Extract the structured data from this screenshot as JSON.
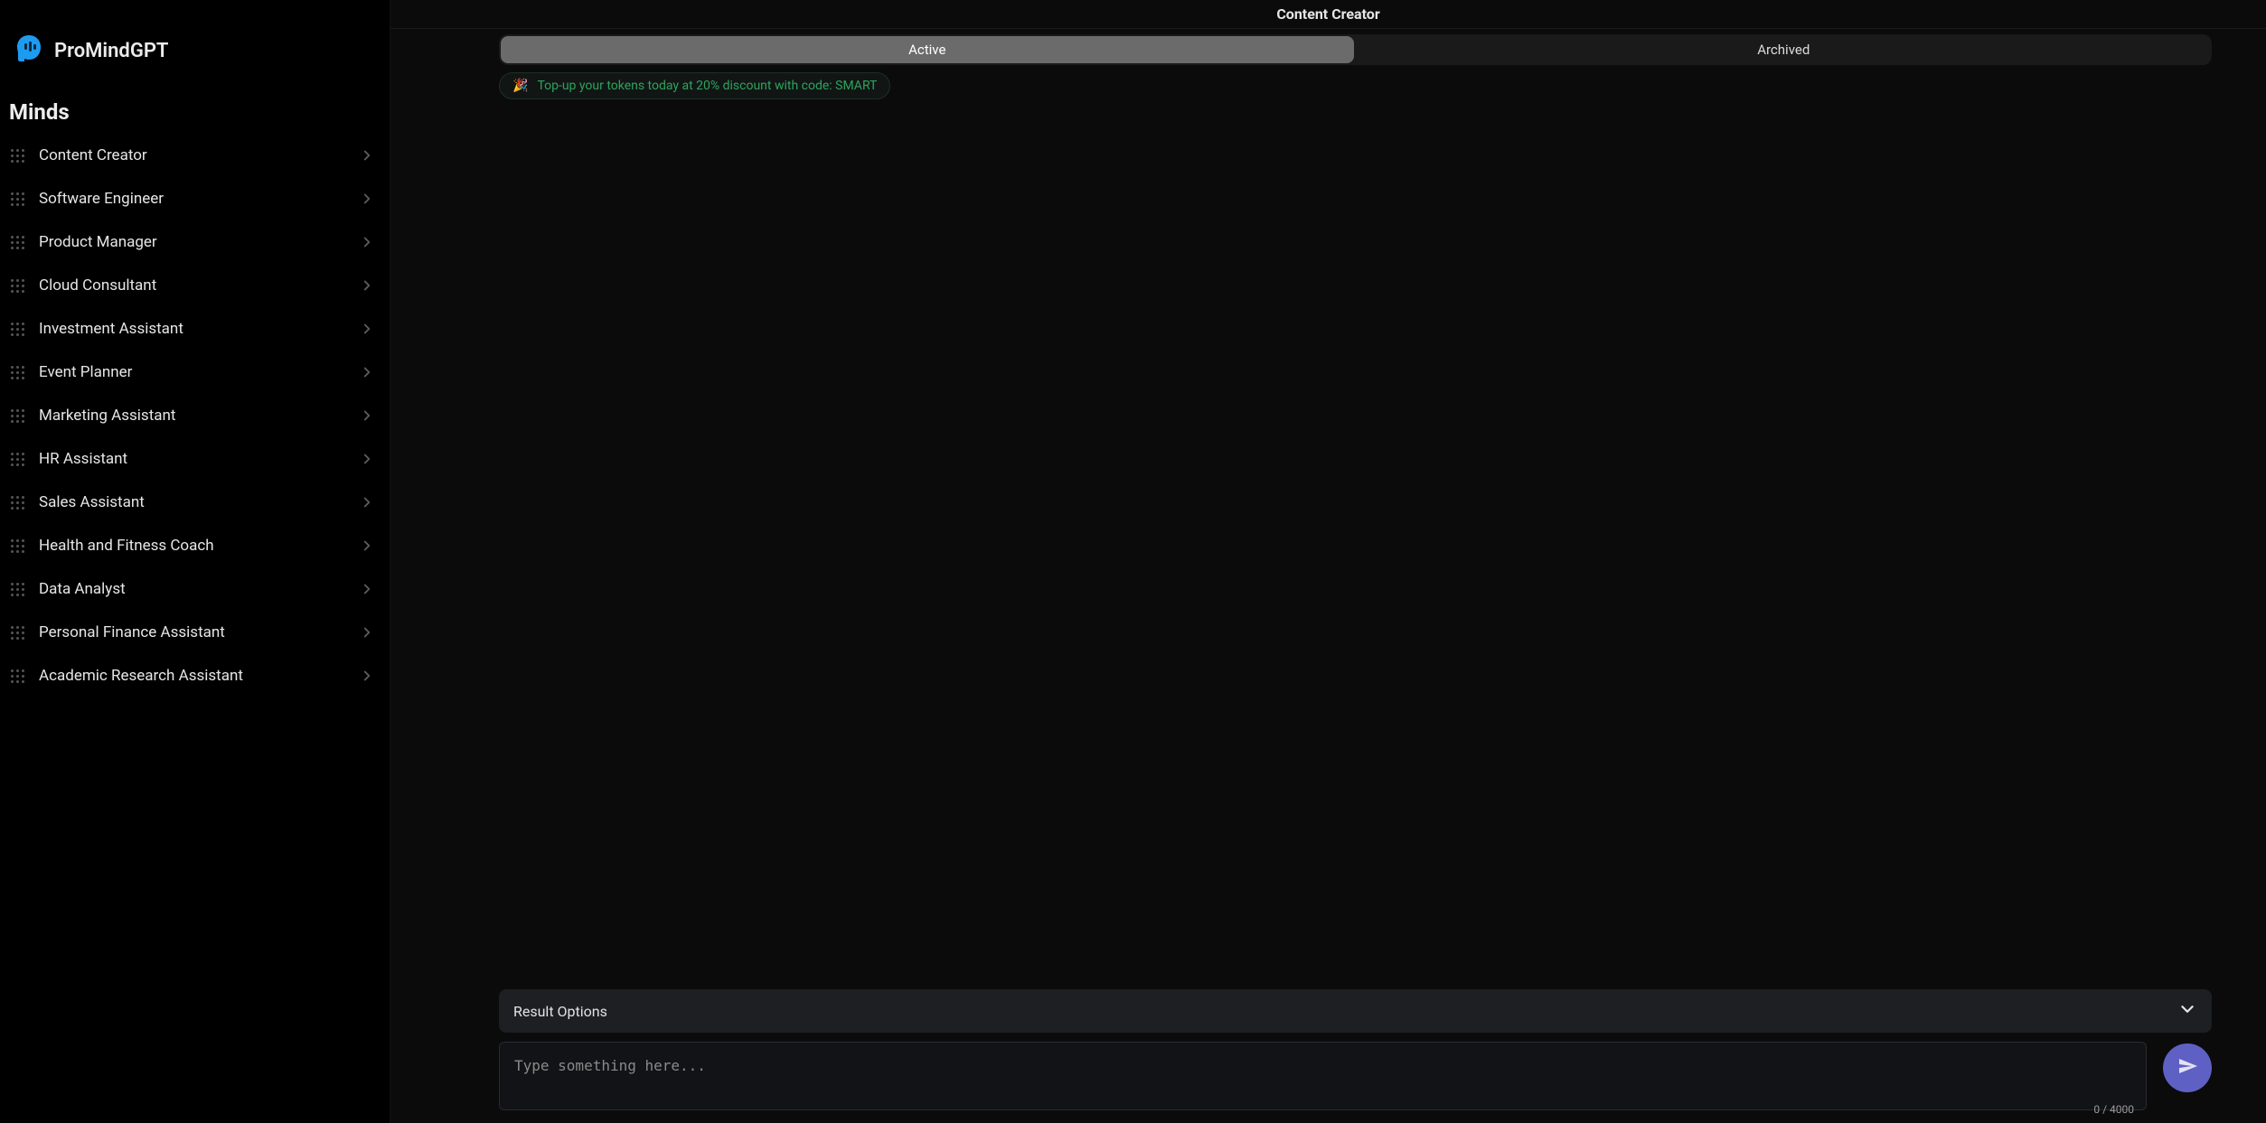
{
  "brand": {
    "name": "ProMindGPT"
  },
  "sidebar": {
    "section_title": "Minds",
    "items": [
      {
        "label": "Content Creator"
      },
      {
        "label": "Software Engineer"
      },
      {
        "label": "Product Manager"
      },
      {
        "label": "Cloud Consultant"
      },
      {
        "label": "Investment Assistant"
      },
      {
        "label": "Event Planner"
      },
      {
        "label": "Marketing Assistant"
      },
      {
        "label": "HR Assistant"
      },
      {
        "label": "Sales Assistant"
      },
      {
        "label": "Health and Fitness Coach"
      },
      {
        "label": "Data Analyst"
      },
      {
        "label": "Personal Finance Assistant"
      },
      {
        "label": "Academic Research Assistant"
      }
    ]
  },
  "main": {
    "title": "Content Creator",
    "tabs": {
      "active": "Active",
      "archived": "Archived"
    },
    "banner": {
      "emoji": "🎉",
      "text": "Top-up your tokens today at 20% discount with code: SMART"
    },
    "result_options_label": "Result Options",
    "input": {
      "placeholder": "Type something here...",
      "char_count": "0 / 4000"
    }
  }
}
